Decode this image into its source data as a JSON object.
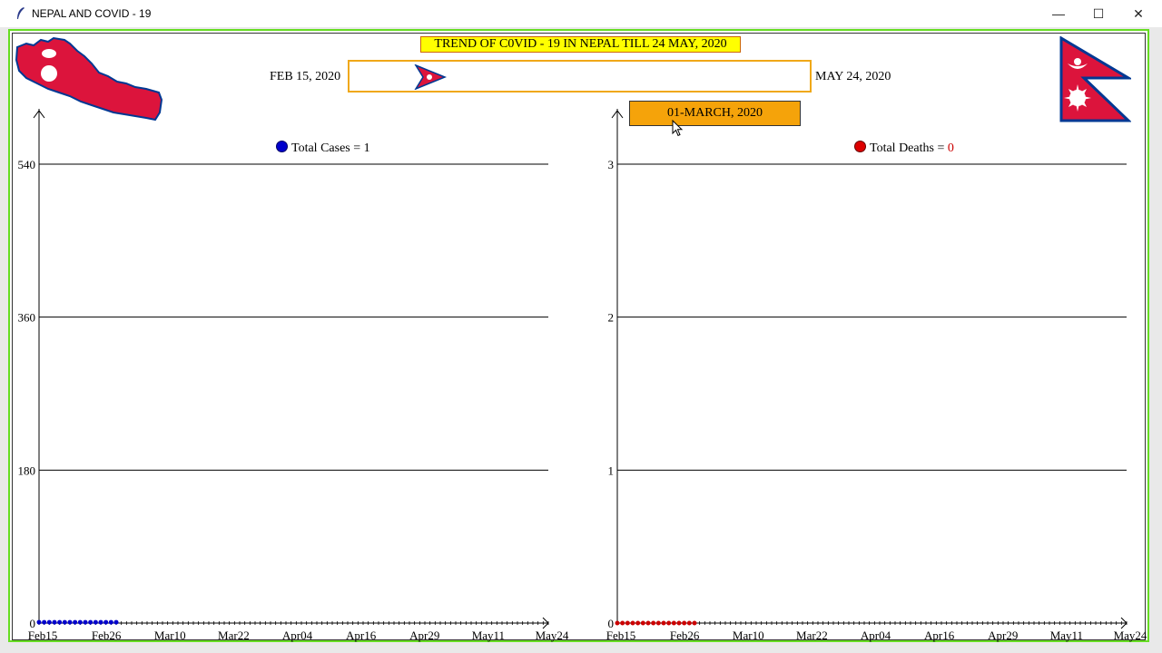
{
  "window": {
    "title": "NEPAL AND COVID - 19",
    "controls": {
      "minimize": "—",
      "maximize": "☐",
      "close": "✕"
    }
  },
  "header": {
    "title": "TREND OF C0VID - 19 IN NEPAL TILL 24 MAY, 2020",
    "start_date": "FEB 15, 2020",
    "end_date": "MAY 24, 2020",
    "current_date": "01-MARCH, 2020",
    "slider_position": 0.15
  },
  "legends": {
    "cases": {
      "label": "Total Cases = ",
      "value": "1"
    },
    "deaths": {
      "label": "Total Deaths = ",
      "value": "0"
    }
  },
  "colors": {
    "cases": "#0000cc",
    "deaths": "#cc0000",
    "frame": "#66dd22",
    "title_bg": "#ffff00",
    "date_box_bg": "#f5a30a",
    "slider_border": "#f0a818",
    "flag_red": "#dc143c",
    "flag_blue": "#003893"
  },
  "chart_data": [
    {
      "type": "scatter",
      "x_ticks": [
        "Feb15",
        "Feb26",
        "Mar10",
        "Mar22",
        "Apr04",
        "Apr16",
        "Apr29",
        "May11",
        "May24"
      ],
      "y_ticks": [
        "0",
        "180",
        "360",
        "540"
      ],
      "ylim": [
        0,
        540
      ],
      "grid": true,
      "legend": "top-center",
      "series": [
        {
          "name": "Total Cases",
          "x": [
            "Feb 15",
            "Feb 16",
            "Feb 17",
            "Feb 18",
            "Feb 19",
            "Feb 20",
            "Feb 21",
            "Feb 22",
            "Feb 23",
            "Feb 24",
            "Feb 25",
            "Feb 26",
            "Feb 27",
            "Feb 28",
            "Feb 29",
            "Mar 01"
          ],
          "values": [
            1,
            1,
            1,
            1,
            1,
            1,
            1,
            1,
            1,
            1,
            1,
            1,
            1,
            1,
            1,
            1
          ]
        }
      ]
    },
    {
      "type": "scatter",
      "x_ticks": [
        "Feb15",
        "Feb26",
        "Mar10",
        "Mar22",
        "Apr04",
        "Apr16",
        "Apr29",
        "May11",
        "May24"
      ],
      "y_ticks": [
        "0",
        "1",
        "2",
        "3"
      ],
      "ylim": [
        0,
        3
      ],
      "grid": true,
      "legend": "top-center",
      "series": [
        {
          "name": "Total Deaths",
          "x": [
            "Feb 15",
            "Feb 16",
            "Feb 17",
            "Feb 18",
            "Feb 19",
            "Feb 20",
            "Feb 21",
            "Feb 22",
            "Feb 23",
            "Feb 24",
            "Feb 25",
            "Feb 26",
            "Feb 27",
            "Feb 28",
            "Feb 29",
            "Mar 01"
          ],
          "values": [
            0,
            0,
            0,
            0,
            0,
            0,
            0,
            0,
            0,
            0,
            0,
            0,
            0,
            0,
            0,
            0
          ]
        }
      ]
    }
  ]
}
